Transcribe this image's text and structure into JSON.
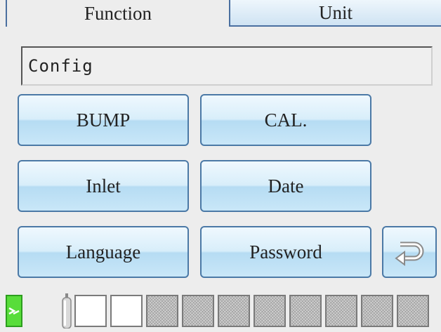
{
  "tabs": [
    {
      "label": "Function",
      "active": true
    },
    {
      "label": "Unit",
      "active": false
    }
  ],
  "title_field": {
    "value": "Config"
  },
  "buttons": {
    "bump": "BUMP",
    "cal": "CAL.",
    "inlet": "Inlet",
    "date": "Date",
    "language": "Language",
    "password": "Password",
    "back_icon": "return-arrow-icon"
  },
  "status_bar": {
    "sd_icon": "sd-card-icon",
    "sd_color": "#58dd3a",
    "cylinder_icon": "gas-cylinder-icon",
    "slots": [
      "empty",
      "empty",
      "filled",
      "filled",
      "filled",
      "filled",
      "filled",
      "filled",
      "filled",
      "filled"
    ]
  },
  "colors": {
    "button_border": "#4b79a6",
    "button_fill": "#c9e7f8",
    "background": "#ededed"
  }
}
